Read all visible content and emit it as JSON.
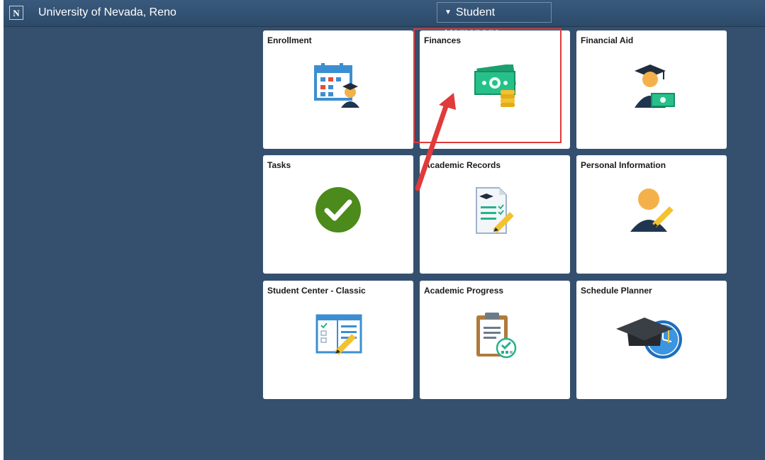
{
  "header": {
    "logo_text": "N",
    "institution": "University of Nevada, Reno",
    "homepage_selector": "Student Homepage"
  },
  "tiles": [
    {
      "title": "Enrollment",
      "icon": "calendar-student-icon"
    },
    {
      "title": "Finances",
      "icon": "money-coins-icon"
    },
    {
      "title": "Financial Aid",
      "icon": "graduate-money-icon"
    },
    {
      "title": "Tasks",
      "icon": "checkmark-icon"
    },
    {
      "title": "Academic Records",
      "icon": "transcript-icon"
    },
    {
      "title": "Personal Information",
      "icon": "person-edit-icon"
    },
    {
      "title": "Student Center - Classic",
      "icon": "classic-form-icon"
    },
    {
      "title": "Academic Progress",
      "icon": "clipboard-progress-icon"
    },
    {
      "title": "Schedule Planner",
      "icon": "cap-clock-icon"
    }
  ],
  "colors": {
    "page_bg": "#34506e",
    "tile_bg": "#ffffff",
    "annotation": "#e03a3a"
  }
}
